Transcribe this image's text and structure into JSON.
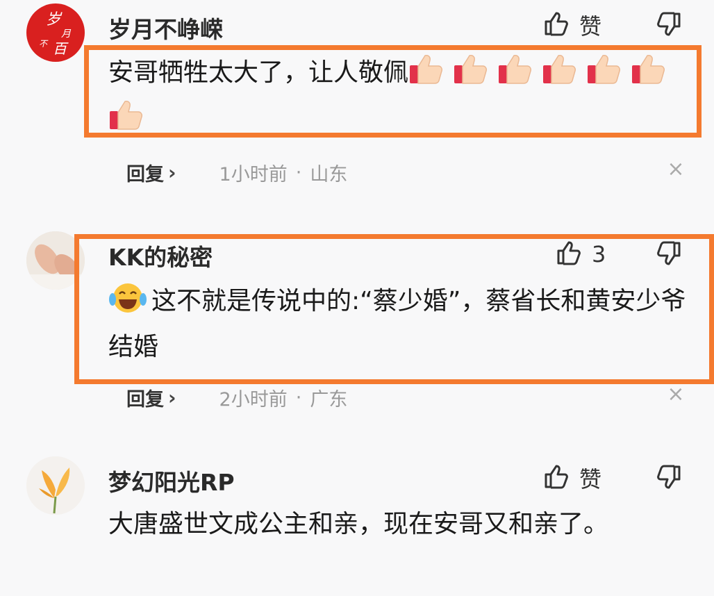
{
  "comments": [
    {
      "author": "岁月不峥嵘",
      "avatar_text": [
        "岁",
        "月",
        "不",
        "百"
      ],
      "like_label": "赞",
      "text": "安哥牺牲太大了，让人敬佩",
      "emoji_count": 7,
      "emoji_name": "thumbs-up-emoji",
      "reply_label": "回复",
      "time": "1小时前",
      "location": "山东"
    },
    {
      "author": "KK的秘密",
      "like_label": "3",
      "text": "这不就是传说中的:“蔡少婚”，蔡省长和黄安少爷结婚",
      "emoji_name": "laughing-crying-emoji",
      "reply_label": "回复",
      "time": "2小时前",
      "location": "广东"
    },
    {
      "author": "梦幻阳光RP",
      "like_label": "赞",
      "text": "大唐盛世文成公主和亲，现在安哥又和亲了。"
    }
  ],
  "ui": {
    "chevron": "›",
    "dot": "·",
    "close": "×"
  },
  "colors": {
    "highlight": "#f47a2f",
    "avatar1": "#d9201f",
    "background": "#f8f8f9"
  }
}
